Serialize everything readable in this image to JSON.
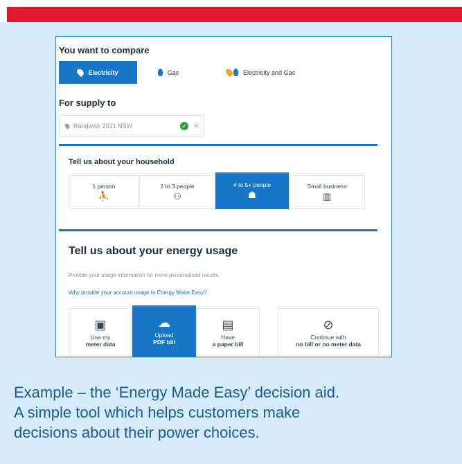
{
  "compare": {
    "title": "You want to compare",
    "tabs": [
      {
        "label": "Electricity",
        "active": true,
        "icon": "map-pin-icon"
      },
      {
        "label": "Gas",
        "active": false,
        "icon": "gas-flame-icon"
      },
      {
        "label": "Electricity and Gas",
        "active": false,
        "icon": "electricity-gas-icon"
      }
    ]
  },
  "supply": {
    "title": "For supply to",
    "value": "Randwick 2031 NSW"
  },
  "household": {
    "title": "Tell us about your household",
    "options": [
      {
        "label": "1 person",
        "icon": "person-icon",
        "active": false
      },
      {
        "label": "2 to 3 people",
        "icon": "people-icon",
        "active": false
      },
      {
        "label": "4 to 5+ people",
        "icon": "family-icon",
        "active": true
      },
      {
        "label": "Small business",
        "icon": "business-icon",
        "active": false
      }
    ]
  },
  "usage": {
    "title": "Tell us about your energy usage",
    "description": "Provide your usage information for more personalised results.",
    "link": "Why provide your account usage to Energy Made Easy?",
    "options": [
      {
        "line1": "Use my",
        "line2": "meter data",
        "icon": "meter-icon",
        "active": false
      },
      {
        "line1": "Upload",
        "line2": "PDF bill",
        "icon": "cloud-upload-icon",
        "active": true
      },
      {
        "line1": "Have",
        "line2": "a paper bill",
        "icon": "paper-bill-icon",
        "active": false
      },
      {
        "line1": "Continue with",
        "line2": "no bill or no meter data",
        "icon": "no-data-icon",
        "active": false
      }
    ]
  },
  "caption": {
    "line1": "Example – the ‘Energy Made Easy’ decision aid.",
    "line2": "A simple tool which helps customers make",
    "line3": "decisions about their power choices."
  },
  "colors": {
    "accent_red": "#e0192f",
    "brand_blue": "#1876c8",
    "background": "#d6ecfb",
    "caption_text": "#1d5a94"
  }
}
